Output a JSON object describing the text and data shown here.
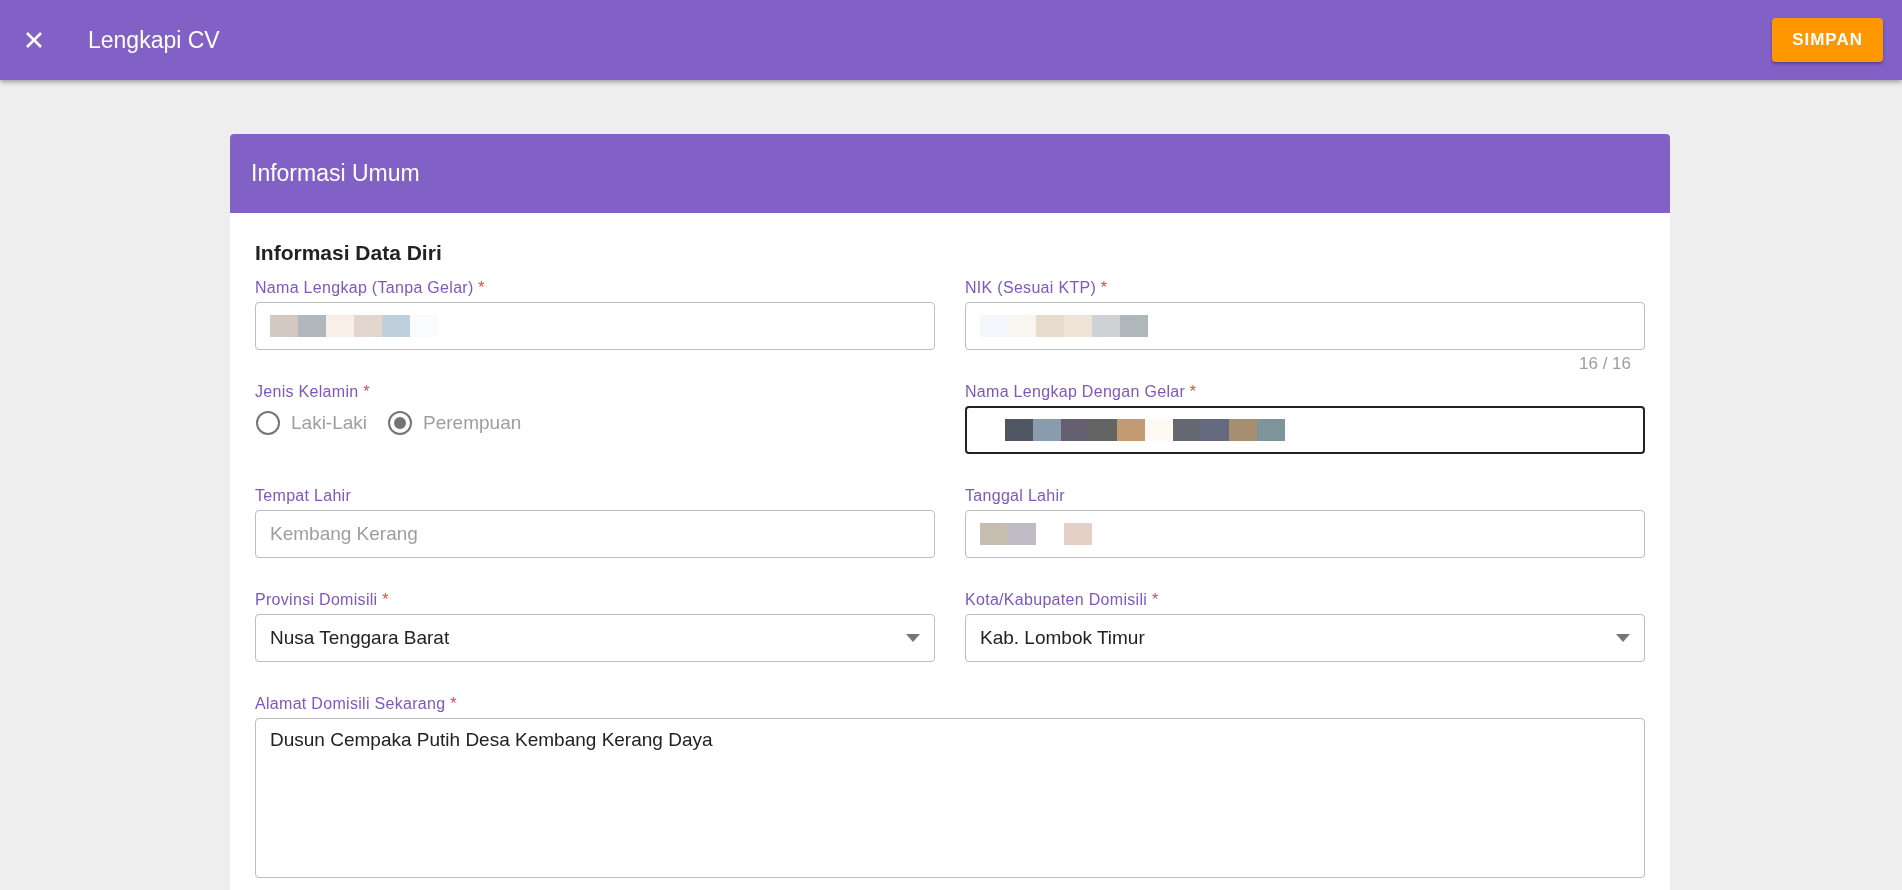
{
  "app_bar": {
    "title": "Lengkapi CV",
    "save_button": "SIMPAN"
  },
  "card": {
    "title": "Informasi Umum",
    "section_title": "Informasi Data Diri",
    "rows": [
      [
        {
          "kind": "redacted",
          "label": "Nama Lengkap (Tanpa Gelar)",
          "required_mark": "*",
          "focused": false
        },
        {
          "kind": "redacted",
          "label": "NIK (Sesuai KTP)",
          "required_mark": "*",
          "focused": false,
          "counter": "16 / 16"
        }
      ],
      [
        {
          "kind": "radio",
          "label": "Jenis Kelamin",
          "required_mark": "*",
          "options": [
            {
              "label": "Laki-Laki",
              "selected": false
            },
            {
              "label": "Perempuan",
              "selected": true
            }
          ]
        },
        {
          "kind": "redacted",
          "label": "Nama Lengkap Dengan Gelar",
          "required_mark": "*",
          "focused": true
        }
      ],
      [
        {
          "kind": "text",
          "label": "Tempat Lahir",
          "placeholder": "Kembang Kerang",
          "focused": false
        },
        {
          "kind": "redacted",
          "label": "Tanggal Lahir",
          "focused": false
        }
      ],
      [
        {
          "kind": "select",
          "label": "Provinsi Domisili",
          "required_mark": "*",
          "value": "Nusa Tenggara Barat",
          "focused": false
        },
        {
          "kind": "select",
          "label": "Kota/Kabupaten Domisili",
          "required_mark": "*",
          "value": "Kab. Lombok Timur",
          "focused": false
        }
      ],
      [
        {
          "kind": "textarea",
          "label": "Alamat Domisili Sekarang",
          "required_mark": "*",
          "value": "Dusun Cempaka Putih Desa Kembang Kerang Daya",
          "focused": false
        }
      ]
    ]
  }
}
